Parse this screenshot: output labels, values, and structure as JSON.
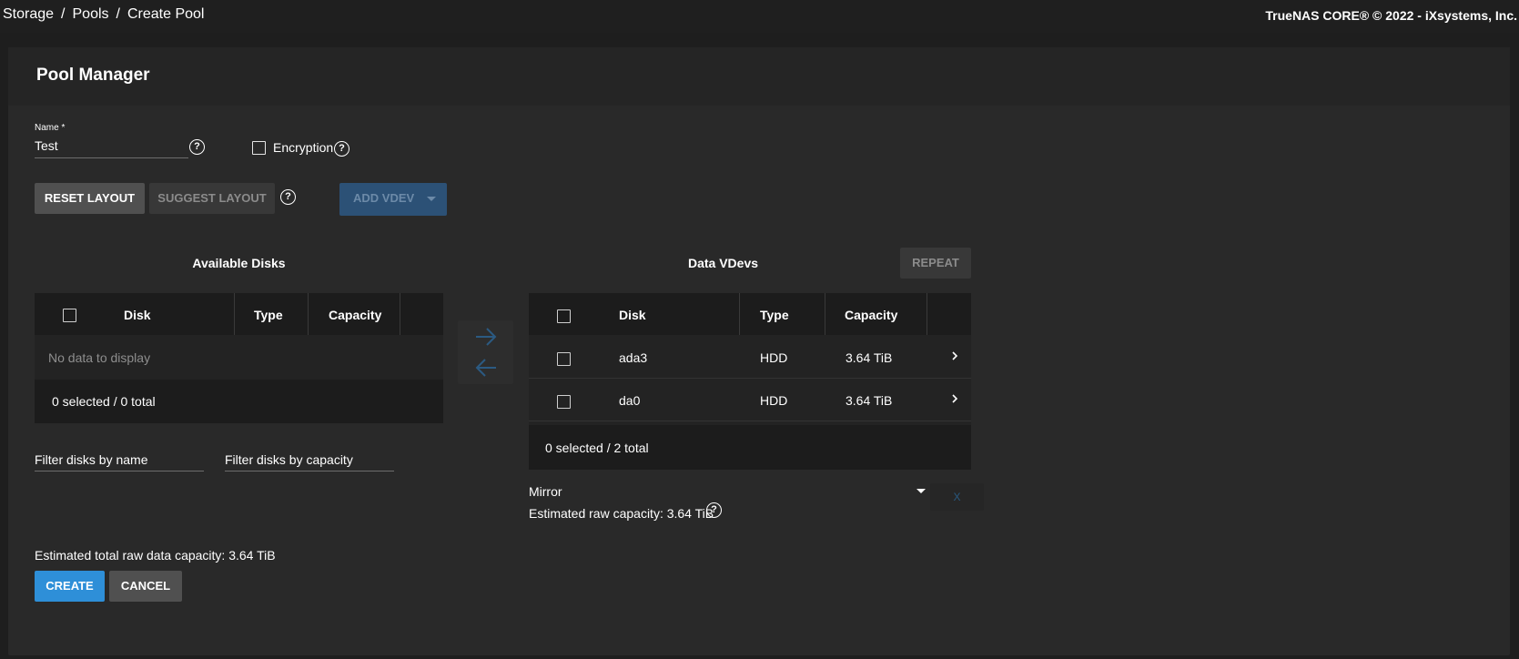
{
  "breadcrumb": {
    "items": [
      "Storage",
      "Pools",
      "Create Pool"
    ],
    "separator": "/"
  },
  "copyright": "TrueNAS CORE® © 2022 - iXsystems, Inc.",
  "page": {
    "title": "Pool Manager"
  },
  "form": {
    "name_label": "Name *",
    "name_value": "Test",
    "encryption_label": "Encryption",
    "encryption_checked": false
  },
  "buttons": {
    "reset_layout": "RESET LAYOUT",
    "suggest_layout": "SUGGEST LAYOUT",
    "add_vdev": "ADD VDEV",
    "repeat": "REPEAT",
    "create": "CREATE",
    "cancel": "CANCEL",
    "remove_vdev": "X"
  },
  "available_disks": {
    "title": "Available Disks",
    "columns": [
      "Disk",
      "Type",
      "Capacity"
    ],
    "empty_message": "No data to display",
    "footer": "0 selected / 0 total",
    "filter_name_placeholder": "Filter disks by name",
    "filter_capacity_placeholder": "Filter disks by capacity"
  },
  "data_vdevs": {
    "title": "Data VDevs",
    "columns": [
      "Disk",
      "Type",
      "Capacity"
    ],
    "rows": [
      {
        "disk": "ada3",
        "type": "HDD",
        "capacity": "3.64 TiB"
      },
      {
        "disk": "da0",
        "type": "HDD",
        "capacity": "3.64 TiB"
      }
    ],
    "footer": "0 selected / 2 total",
    "layout": "Mirror",
    "estimated_raw_capacity": "Estimated raw capacity: 3.64 TiB"
  },
  "estimated_total": "Estimated total raw data capacity: 3.64 TiB",
  "colors": {
    "primary": "#2e8fd8",
    "disabled_primary": "#2c5176",
    "background": "#1e1e1e",
    "card": "#292929"
  },
  "icons": {
    "help": "help-circle-icon",
    "move_right": "arrow-right-icon",
    "move_left": "arrow-left-icon",
    "expand": "chevron-right-icon",
    "dropdown": "caret-down-icon"
  }
}
